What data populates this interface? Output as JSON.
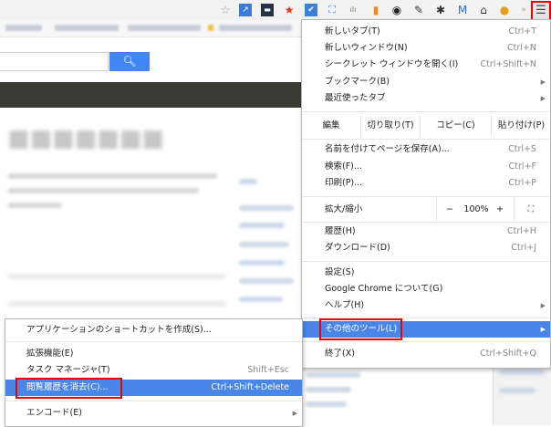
{
  "menu": {
    "items_top": [
      {
        "label": "新しいタブ(T)",
        "shortcut": "Ctrl+T"
      },
      {
        "label": "新しいウィンドウ(N)",
        "shortcut": "Ctrl+N"
      },
      {
        "label": "シークレット ウィンドウを開く(I)",
        "shortcut": "Ctrl+Shift+N"
      },
      {
        "label": "ブックマーク(B)",
        "shortcut": ""
      },
      {
        "label": "最近使ったタブ",
        "shortcut": ""
      }
    ],
    "edit": {
      "label": "編集",
      "cut": "切り取り(T)",
      "copy": "コピー(C)",
      "paste": "貼り付け(P)"
    },
    "items_mid": [
      {
        "label": "名前を付けてページを保存(A)...",
        "shortcut": "Ctrl+S"
      },
      {
        "label": "検索(F)...",
        "shortcut": "Ctrl+F"
      },
      {
        "label": "印刷(P)...",
        "shortcut": "Ctrl+P"
      }
    ],
    "zoom": {
      "label": "拡大/縮小",
      "minus": "−",
      "value": "100%",
      "plus": "+",
      "fullscreen": "⛶"
    },
    "items_hist": [
      {
        "label": "履歴(H)",
        "shortcut": "Ctrl+H"
      },
      {
        "label": "ダウンロード(D)",
        "shortcut": "Ctrl+J"
      }
    ],
    "settings": "設定(S)",
    "about": "Google Chrome について(G)",
    "help": "ヘルプ(H)",
    "more_tools": "その他のツール(L)",
    "exit": {
      "label": "終了(X)",
      "shortcut": "Ctrl+Shift+Q"
    }
  },
  "submenu": {
    "create_shortcut": "アプリケーションのショートカットを作成(S)...",
    "extensions": "拡張機能(E)",
    "task_manager": {
      "label": "タスク マネージャ(T)",
      "shortcut": "Shift+Esc"
    },
    "clear_browsing": {
      "label": "閲覧履歴を消去(C)...",
      "shortcut": "Ctrl+Shift+Delete"
    },
    "encoding": "エンコード(E)"
  },
  "page": {
    "search_icon": "search-icon",
    "menu_icon": "hamburger-icon"
  },
  "colors": {
    "highlight": "#4a86e8",
    "annotation": "#e00000",
    "search_button": "#4285f4"
  }
}
